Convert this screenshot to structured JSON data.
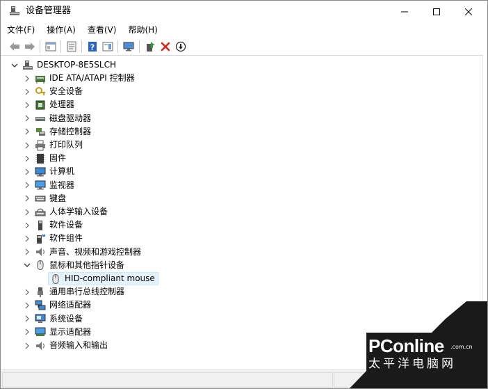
{
  "window": {
    "title": "设备管理器"
  },
  "menu": [
    {
      "label": "文件(F)"
    },
    {
      "label": "操作(A)"
    },
    {
      "label": "查看(V)"
    },
    {
      "label": "帮助(H)"
    }
  ],
  "tree": {
    "root": "DESKTOP-8E5SLCH",
    "items": [
      {
        "label": "IDE ATA/ATAPI 控制器",
        "icon": "ide-controller-icon"
      },
      {
        "label": "安全设备",
        "icon": "security-device-icon"
      },
      {
        "label": "处理器",
        "icon": "processor-icon"
      },
      {
        "label": "磁盘驱动器",
        "icon": "disk-drive-icon"
      },
      {
        "label": "存储控制器",
        "icon": "storage-controller-icon"
      },
      {
        "label": "打印队列",
        "icon": "printer-icon"
      },
      {
        "label": "固件",
        "icon": "firmware-icon"
      },
      {
        "label": "计算机",
        "icon": "computer-icon"
      },
      {
        "label": "监视器",
        "icon": "monitor-icon"
      },
      {
        "label": "键盘",
        "icon": "keyboard-icon"
      },
      {
        "label": "人体学输入设备",
        "icon": "hid-icon"
      },
      {
        "label": "软件设备",
        "icon": "software-device-icon"
      },
      {
        "label": "软件组件",
        "icon": "software-component-icon"
      },
      {
        "label": "声音、视频和游戏控制器",
        "icon": "speaker-icon"
      },
      {
        "label": "鼠标和其他指针设备",
        "icon": "mouse-icon",
        "expanded": true
      },
      {
        "label": "HID-compliant mouse",
        "icon": "mouse-icon",
        "child": true,
        "selected": true
      },
      {
        "label": "通用串行总线控制器",
        "icon": "usb-icon"
      },
      {
        "label": "网络适配器",
        "icon": "network-adapter-icon"
      },
      {
        "label": "系统设备",
        "icon": "system-device-icon"
      },
      {
        "label": "显示适配器",
        "icon": "display-adapter-icon"
      },
      {
        "label": "音频输入和输出",
        "icon": "audio-io-icon"
      }
    ]
  },
  "watermark": {
    "brand": "PConline",
    "domain": ".com.cn",
    "subtitle": "太平洋电脑网"
  },
  "colors": {
    "selection": "#e5f3ff",
    "delete_red": "#e0241b",
    "help_blue": "#2b63c6"
  }
}
